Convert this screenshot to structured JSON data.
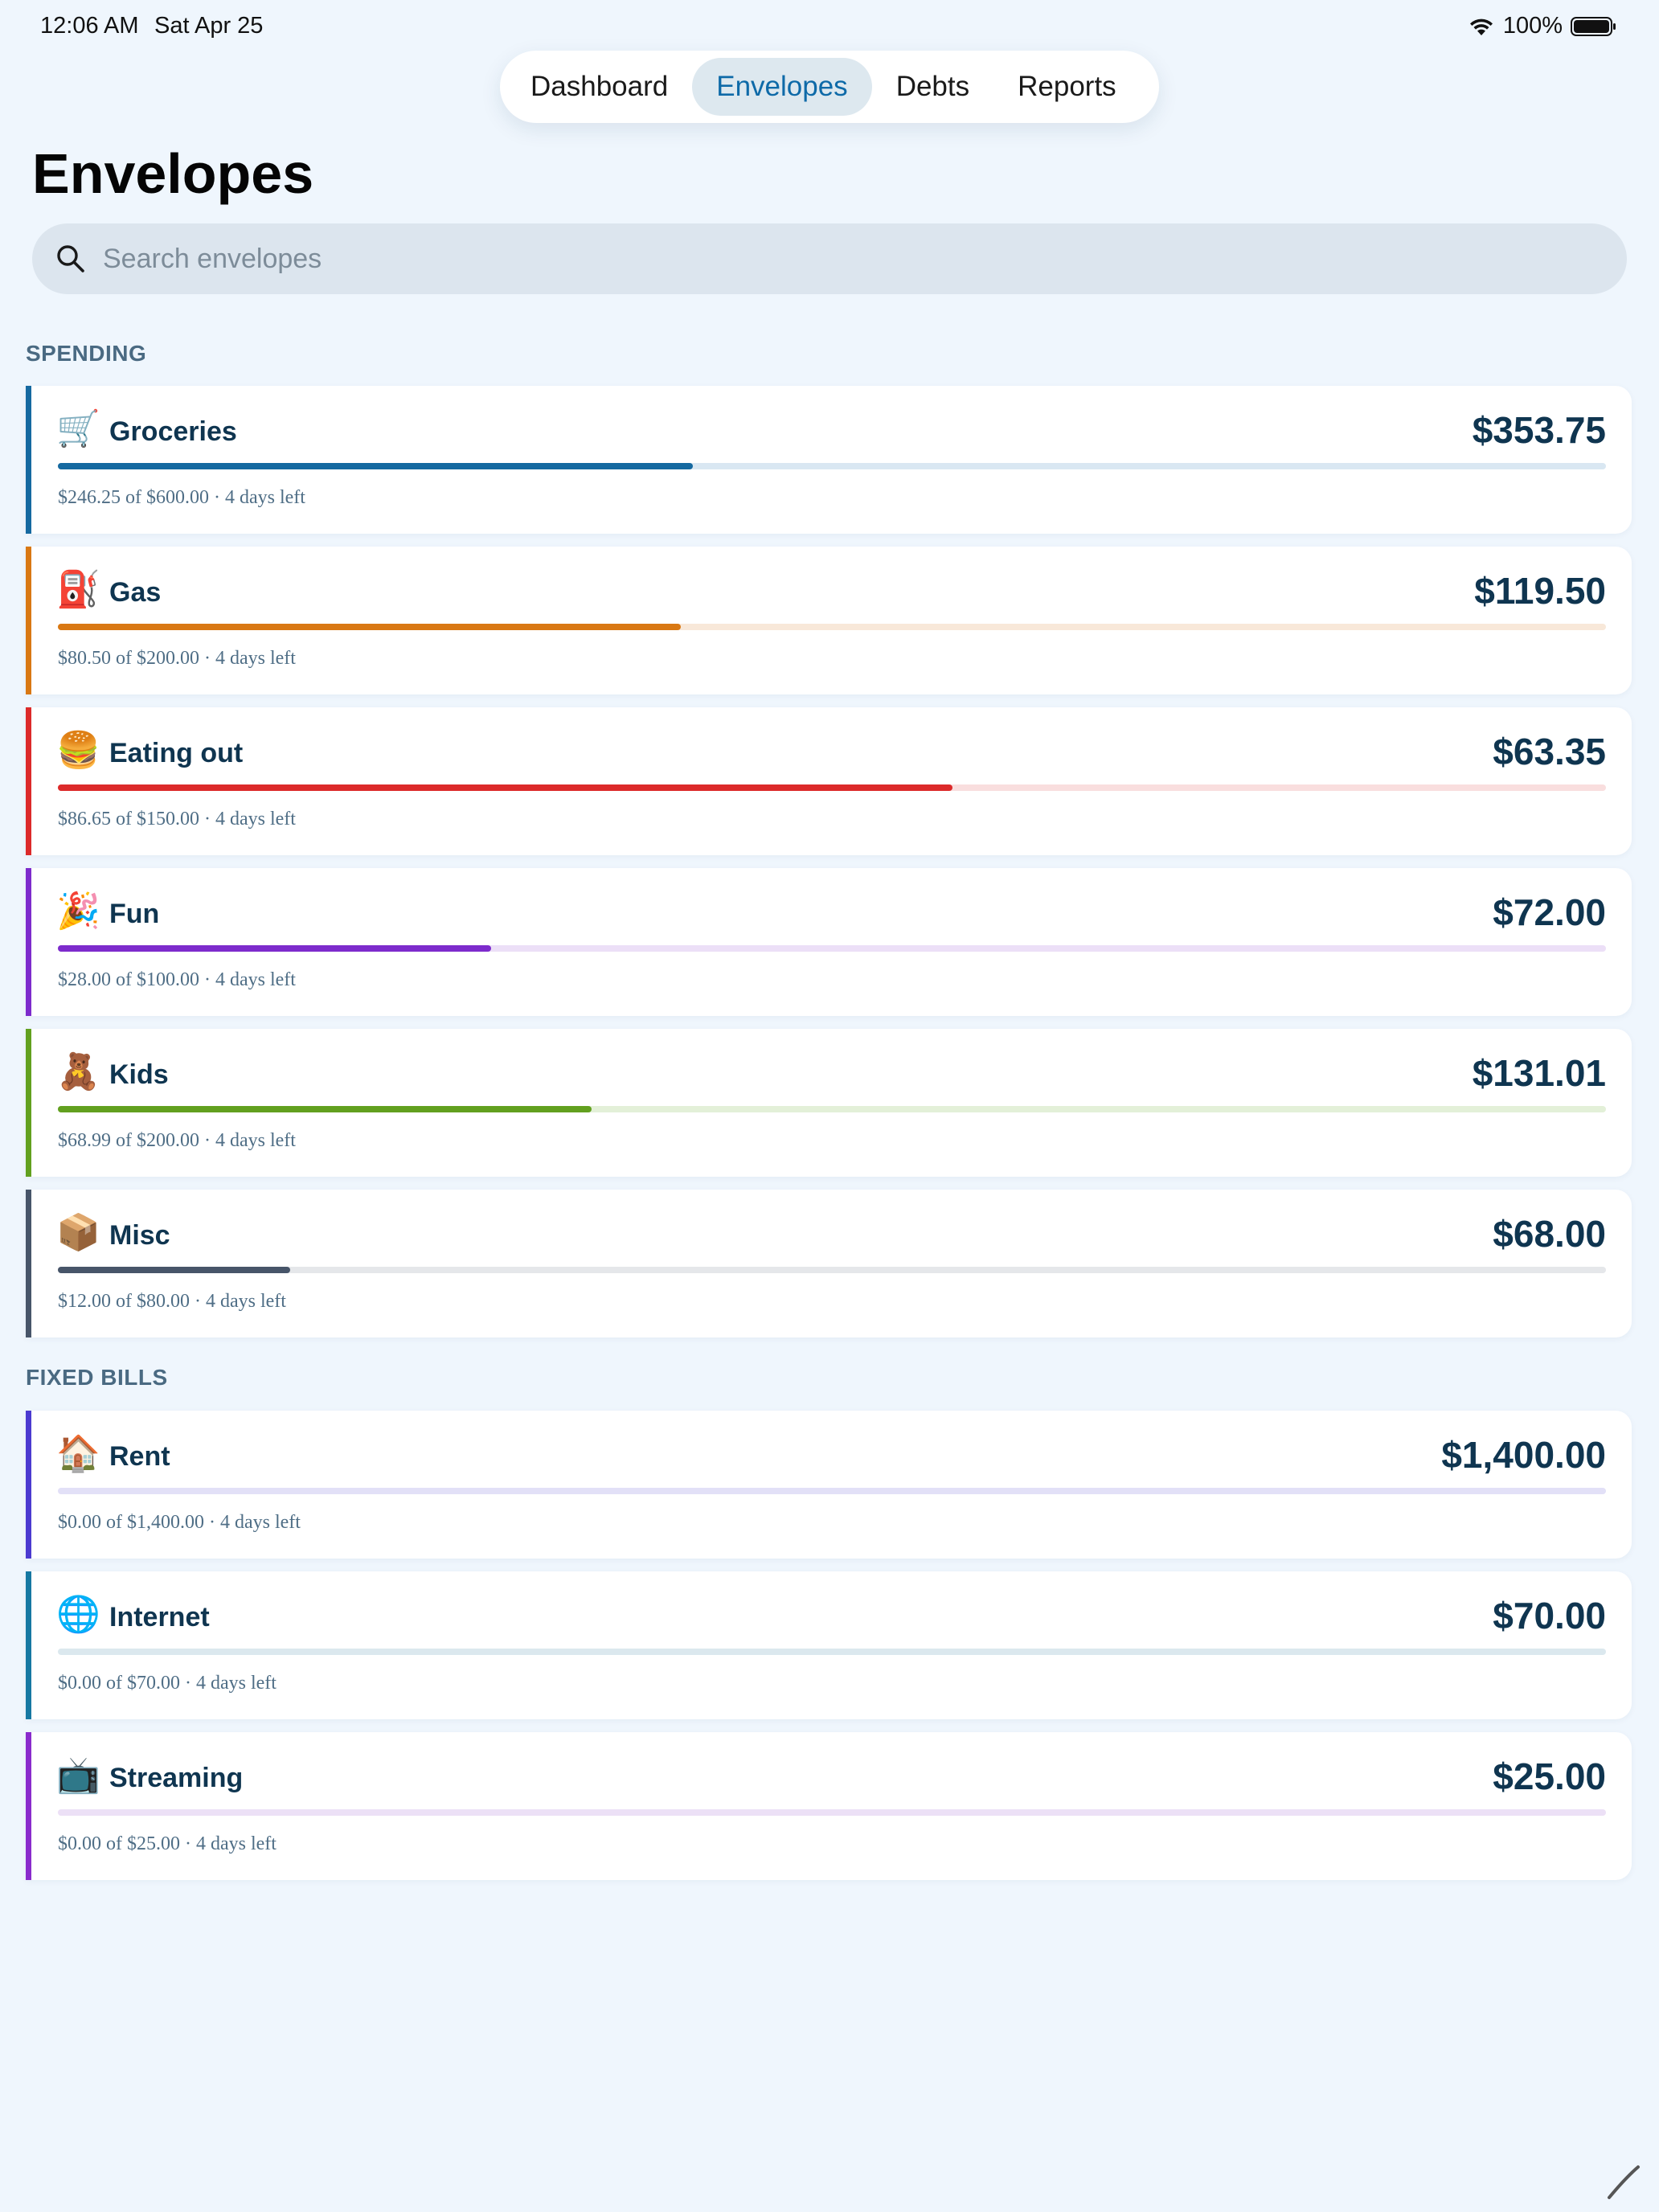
{
  "status": {
    "time": "12:06 AM",
    "date": "Sat Apr 25",
    "battery": "100%"
  },
  "tabs": [
    {
      "label": "Dashboard",
      "active": false
    },
    {
      "label": "Envelopes",
      "active": true
    },
    {
      "label": "Debts",
      "active": false
    },
    {
      "label": "Reports",
      "active": false
    }
  ],
  "page_title": "Envelopes",
  "search": {
    "placeholder": "Search envelopes",
    "value": ""
  },
  "sections": [
    {
      "title": "SPENDING",
      "envelopes": [
        {
          "emoji": "🛒",
          "name": "Groceries",
          "amount": "$353.75",
          "meta": "$246.25 of $600.00 · 4 days left",
          "progress": 0.41,
          "color": "#1569a0",
          "track": "#d9e7f2"
        },
        {
          "emoji": "⛽",
          "name": "Gas",
          "amount": "$119.50",
          "meta": "$80.50 of $200.00 · 4 days left",
          "progress": 0.4025,
          "color": "#d97813",
          "track": "#f8e8d9"
        },
        {
          "emoji": "🍔",
          "name": "Eating out",
          "amount": "$63.35",
          "meta": "$86.65 of $150.00 · 4 days left",
          "progress": 0.5777,
          "color": "#dc2a2a",
          "track": "#f9dede"
        },
        {
          "emoji": "🎉",
          "name": "Fun",
          "amount": "$72.00",
          "meta": "$28.00 of $100.00 · 4 days left",
          "progress": 0.28,
          "color": "#7d2bcc",
          "track": "#ecdff7"
        },
        {
          "emoji": "🧸",
          "name": "Kids",
          "amount": "$131.01",
          "meta": "$68.99 of $200.00 · 4 days left",
          "progress": 0.345,
          "color": "#62a01f",
          "track": "#e3f0d8"
        },
        {
          "emoji": "📦",
          "name": "Misc",
          "amount": "$68.00",
          "meta": "$12.00 of $80.00 · 4 days left",
          "progress": 0.15,
          "color": "#475569",
          "track": "#e5e7ea"
        }
      ]
    },
    {
      "title": "FIXED BILLS",
      "envelopes": [
        {
          "emoji": "🏠",
          "name": "Rent",
          "amount": "$1,400.00",
          "meta": "$0.00 of $1,400.00 · 4 days left",
          "progress": 0,
          "color": "#4b3ad0",
          "track": "#e2e0f7"
        },
        {
          "emoji": "🌐",
          "name": "Internet",
          "amount": "$70.00",
          "meta": "$0.00 of $70.00 · 4 days left",
          "progress": 0,
          "color": "#1678a2",
          "track": "#dbe8ee"
        },
        {
          "emoji": "📺",
          "name": "Streaming",
          "amount": "$25.00",
          "meta": "$0.00 of $25.00 · 4 days left",
          "progress": 0,
          "color": "#8a2bcc",
          "track": "#ece0f6"
        }
      ]
    }
  ]
}
